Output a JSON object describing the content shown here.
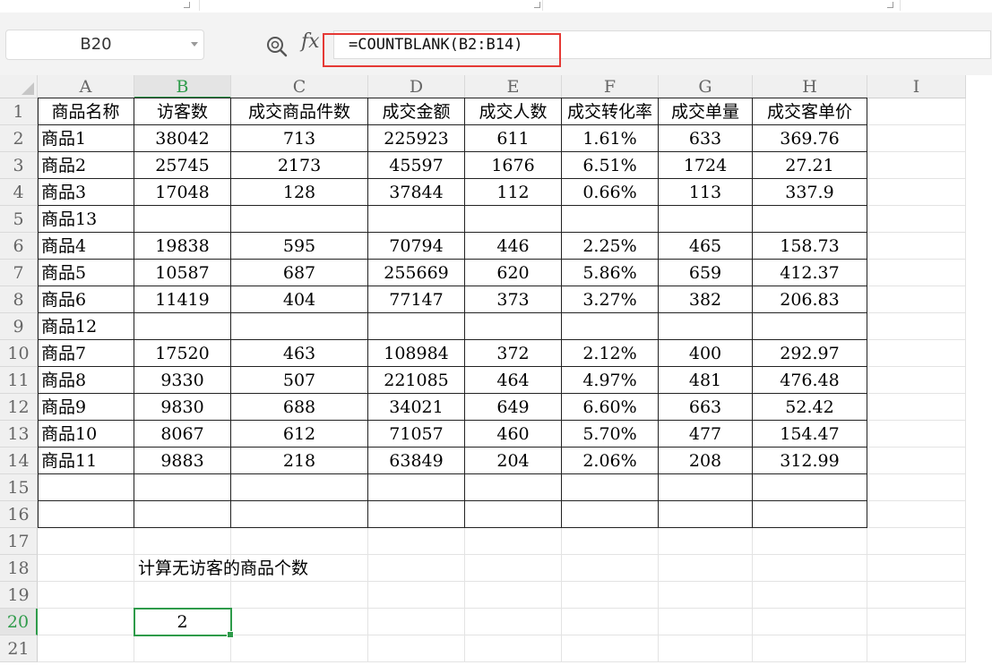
{
  "name_box": {
    "value": "B20"
  },
  "formula_bar": {
    "fx_label": "fx",
    "formula": "=COUNTBLANK(B2:B14)"
  },
  "columns": [
    "A",
    "B",
    "C",
    "D",
    "E",
    "F",
    "G",
    "H",
    "I"
  ],
  "active_column": "B",
  "active_row": 20,
  "headers": [
    "商品名称",
    "访客数",
    "成交商品件数",
    "成交金额",
    "成交人数",
    "成交转化率",
    "成交单量",
    "成交客单价"
  ],
  "rows": [
    [
      "商品1",
      "38042",
      "713",
      "225923",
      "611",
      "1.61%",
      "633",
      "369.76"
    ],
    [
      "商品2",
      "25745",
      "2173",
      "45597",
      "1676",
      "6.51%",
      "1724",
      "27.21"
    ],
    [
      "商品3",
      "17048",
      "128",
      "37844",
      "112",
      "0.66%",
      "113",
      "337.9"
    ],
    [
      "商品13",
      "",
      "",
      "",
      "",
      "",
      "",
      ""
    ],
    [
      "商品4",
      "19838",
      "595",
      "70794",
      "446",
      "2.25%",
      "465",
      "158.73"
    ],
    [
      "商品5",
      "10587",
      "687",
      "255669",
      "620",
      "5.86%",
      "659",
      "412.37"
    ],
    [
      "商品6",
      "11419",
      "404",
      "77147",
      "373",
      "3.27%",
      "382",
      "206.83"
    ],
    [
      "商品12",
      "",
      "",
      "",
      "",
      "",
      "",
      ""
    ],
    [
      "商品7",
      "17520",
      "463",
      "108984",
      "372",
      "2.12%",
      "400",
      "292.97"
    ],
    [
      "商品8",
      "9330",
      "507",
      "221085",
      "464",
      "4.97%",
      "481",
      "476.48"
    ],
    [
      "商品9",
      "9830",
      "688",
      "34021",
      "649",
      "6.60%",
      "663",
      "52.42"
    ],
    [
      "商品10",
      "8067",
      "612",
      "71057",
      "460",
      "5.70%",
      "477",
      "154.47"
    ],
    [
      "商品11",
      "9883",
      "218",
      "63849",
      "204",
      "2.06%",
      "208",
      "312.99"
    ],
    [
      "",
      "",
      "",
      "",
      "",
      "",
      "",
      ""
    ],
    [
      "",
      "",
      "",
      "",
      "",
      "",
      "",
      ""
    ]
  ],
  "note": {
    "row": 18,
    "text": "计算无访客的商品个数"
  },
  "result": {
    "row": 20,
    "value": "2"
  },
  "row_numbers": [
    1,
    2,
    3,
    4,
    5,
    6,
    7,
    8,
    9,
    10,
    11,
    12,
    13,
    14,
    15,
    16,
    17,
    18,
    19,
    20,
    21
  ],
  "colors": {
    "accent_green": "#2e9b4a",
    "highlight_red": "#e53935"
  }
}
